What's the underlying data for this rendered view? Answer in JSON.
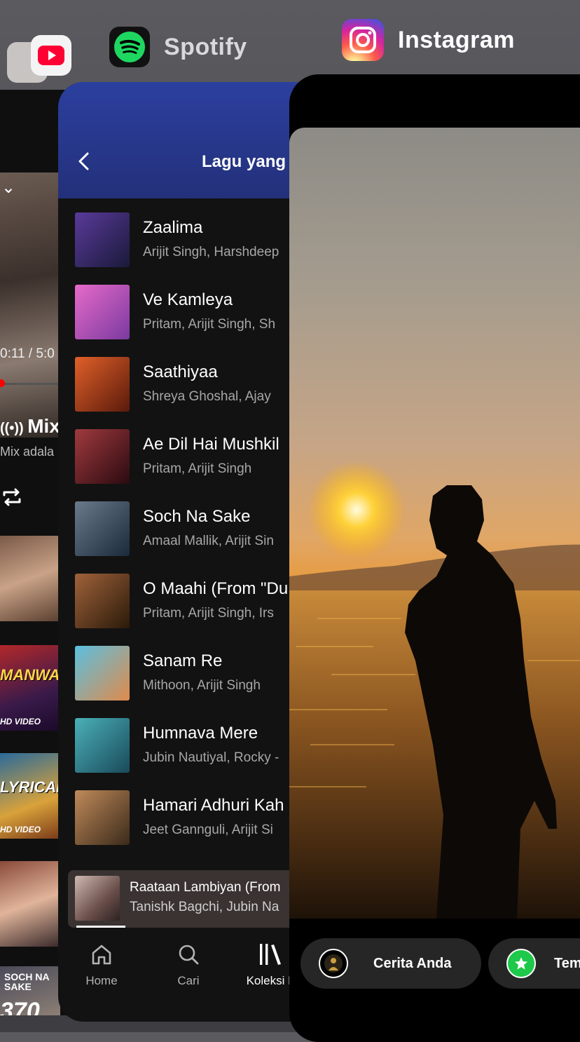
{
  "app_switcher": {
    "apps": [
      {
        "name": "Spotify",
        "icon": "spotify-icon",
        "color": "#1ED760"
      },
      {
        "name": "Instagram",
        "icon": "instagram-icon"
      }
    ],
    "background_apps": [
      {
        "icon": "photos-icon"
      },
      {
        "icon": "youtube-icon",
        "color": "#FF0033"
      }
    ]
  },
  "youtube": {
    "time": "0:11 / 5:0",
    "mix_title": "Mix",
    "mix_subtitle": "Mix adala",
    "thumbnails": [
      {
        "caption": "",
        "big": ""
      },
      {
        "caption": "HD VIDEO",
        "big": "MANWA LA"
      },
      {
        "caption": "HD VIDEO",
        "big": "LYRICAL Saa"
      },
      {
        "caption": "",
        "big": ""
      },
      {
        "caption": "370",
        "big": "SOCH NA SAKE"
      }
    ]
  },
  "spotify": {
    "heading": "Lagu yang",
    "songs": [
      {
        "title": "Zaalima",
        "artists": "Arijit Singh, Harshdeep",
        "art": "#3a2a6a"
      },
      {
        "title": "Ve Kamleya",
        "artists": "Pritam, Arijit Singh, Sh",
        "art": "#c94fb0"
      },
      {
        "title": "Saathiyaa",
        "artists": "Shreya Ghoshal, Ajay",
        "art": "#c0471c"
      },
      {
        "title": "Ae Dil Hai Mushkil",
        "artists": "Pritam, Arijit Singh",
        "art": "#7a2a2e"
      },
      {
        "title": "Soch Na Sake",
        "artists": "Amaal Mallik, Arijit Sin",
        "art": "#4a5a6a"
      },
      {
        "title": "O Maahi (From \"Du",
        "artists": "Pritam, Arijit Singh, Irs",
        "art": "#7a4a2a"
      },
      {
        "title": "Sanam Re",
        "artists": "Mithoon, Arijit Singh",
        "art": "#3aa6c9"
      },
      {
        "title": "Humnava Mere",
        "artists": "Jubin Nautiyal, Rocky -",
        "art": "#2f8f9a"
      },
      {
        "title": "Hamari Adhuri Kah",
        "artists": "Jeet Gannguli, Arijit Si",
        "art": "#8a5a3a"
      }
    ],
    "now_playing": {
      "title": "Raataan Lambiyan (From",
      "artists": "Tanishk Bagchi, Jubin Na"
    },
    "nav": [
      {
        "label": "Home",
        "icon": "home-icon"
      },
      {
        "label": "Cari",
        "icon": "search-icon"
      },
      {
        "label": "Koleksi K",
        "icon": "library-icon"
      }
    ]
  },
  "instagram": {
    "story_buttons": [
      {
        "label": "Cerita Anda",
        "icon": "avatar"
      },
      {
        "label": "Tem",
        "icon": "close-friends-star-icon",
        "color": "#1ec84a"
      }
    ]
  }
}
